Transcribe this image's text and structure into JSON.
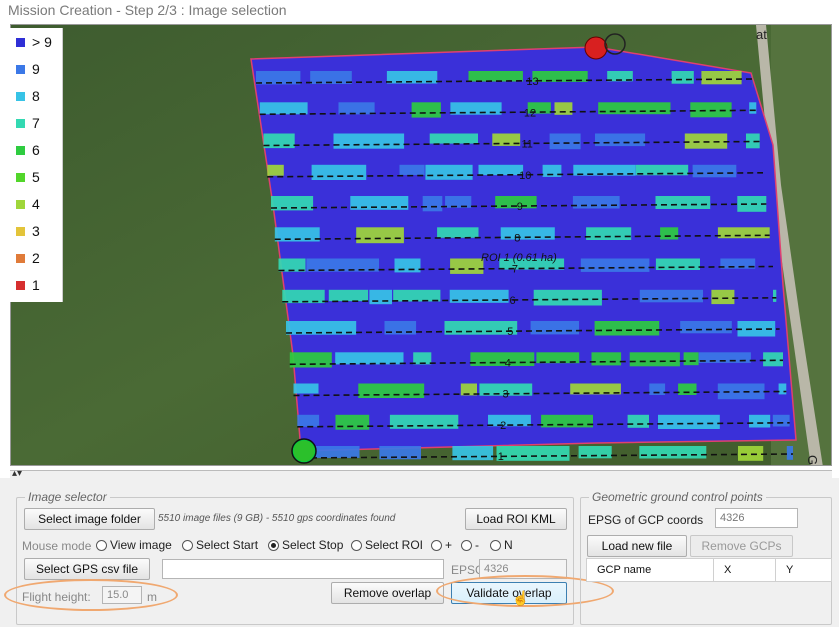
{
  "window": {
    "title": "Mission Creation - Step 2/3 : Image selection"
  },
  "map": {
    "roi_label": "ROI 1 (0.61 ha)",
    "track_numbers": [
      "13",
      "12",
      "11",
      "10",
      "9",
      "8",
      "7",
      "6",
      "5",
      "4",
      "3",
      "2",
      "1"
    ],
    "road_labels": [
      "at",
      "Gabr"
    ]
  },
  "legend": {
    "items": [
      {
        "label": "> 9",
        "color": "#2f2fd6"
      },
      {
        "label": "9",
        "color": "#3b78e7"
      },
      {
        "label": "8",
        "color": "#37c3e6"
      },
      {
        "label": "7",
        "color": "#33d9b2"
      },
      {
        "label": "6",
        "color": "#2ecc40"
      },
      {
        "label": "5",
        "color": "#52d62a"
      },
      {
        "label": "4",
        "color": "#9fd63a"
      },
      {
        "label": "3",
        "color": "#e3c43a"
      },
      {
        "label": "2",
        "color": "#e07b39"
      },
      {
        "label": "1",
        "color": "#d62f2f"
      }
    ]
  },
  "image_selector": {
    "title": "Image selector",
    "select_folder_label": "Select image folder",
    "files_status": "5510 image files (9 GB) - 5510 gps coordinates found",
    "load_roi_label": "Load ROI KML",
    "mouse_mode_label": "Mouse mode",
    "mouse_modes": [
      {
        "label": "View image",
        "checked": false
      },
      {
        "label": "Select Start",
        "checked": false
      },
      {
        "label": "Select Stop",
        "checked": true
      },
      {
        "label": "Select ROI",
        "checked": false
      },
      {
        "label": "+",
        "checked": false
      },
      {
        "label": "-",
        "checked": false
      },
      {
        "label": "N",
        "checked": false
      }
    ],
    "select_gps_label": "Select GPS csv file",
    "gps_path_value": "",
    "epsg_label": "EPSG",
    "epsg_value": "4326",
    "flight_height_label": "Flight height:",
    "flight_height_value": "15.0",
    "flight_height_unit": "m",
    "remove_overlap_label": "Remove overlap",
    "validate_overlap_label": "Validate overlap"
  },
  "gcp": {
    "title": "Geometric ground control points",
    "epsg_label": "EPSG of GCP coords",
    "epsg_value": "4326",
    "load_file_label": "Load new file",
    "remove_label": "Remove GCPs",
    "columns": [
      "GCP name",
      "X",
      "Y"
    ]
  }
}
